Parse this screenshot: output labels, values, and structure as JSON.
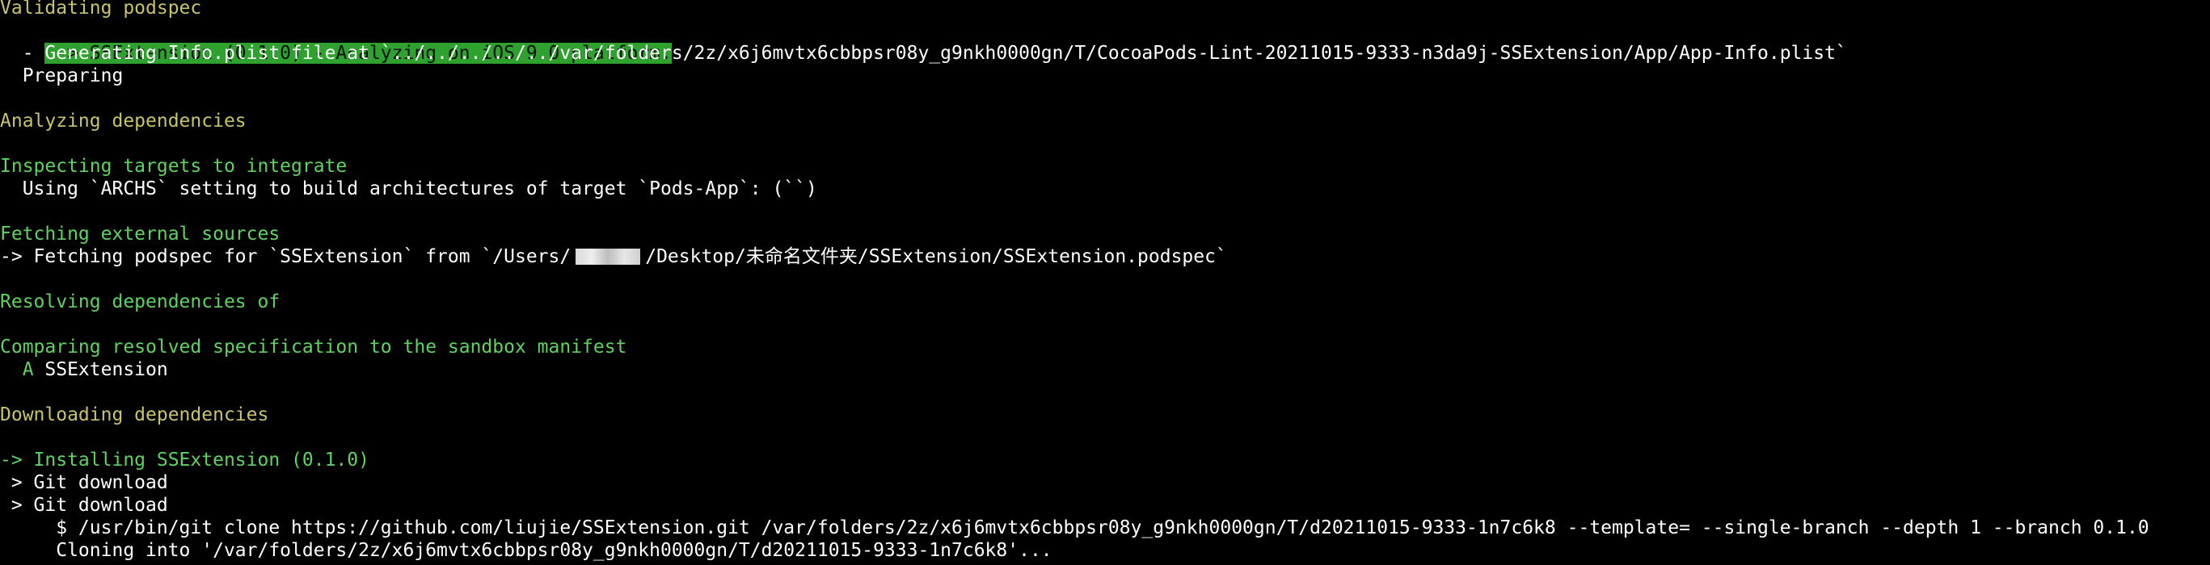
{
  "colors": {
    "background": "#000000",
    "section_yellow": "#c8c468",
    "section_green": "#5fd35f",
    "highlight": "#2ea12e"
  },
  "lines": {
    "validating": "Validating podspec",
    "analyzing_platform": " -> SSExtension (0.1.0) - Analyzing on iOS 9.0 platform.",
    "generating_info": "  - Generating Info.plist file at `../../../../../var/folders/2z/x6j6mvtx6cbbpsr08y_g9nkh0000gn/T/CocoaPods-Lint-20211015-9333-n3da9j-SSExtension/App/App-Info.plist`",
    "preparing": "  Preparing",
    "analyzing_deps": "Analyzing dependencies",
    "inspecting": "Inspecting targets to integrate",
    "using_archs": "  Using `ARCHS` setting to build architectures of target `Pods-App`: (``)",
    "fetching_external": "Fetching external sources",
    "fetching_prefix": "-> Fetching podspec for `SSExtension` from `/Users/",
    "fetching_suffix": "/Desktop/未命名文件夹/SSExtension/SSExtension.podspec`",
    "resolving": "Resolving dependencies of",
    "comparing": "Comparing resolved specification to the sandbox manifest",
    "added_marker": "  A",
    "added_pod": " SSExtension",
    "downloading": "Downloading dependencies",
    "installing": "-> Installing SSExtension (0.1.0)",
    "git_download_1": " > Git download",
    "git_download_2": " > Git download",
    "git_clone": "     $ /usr/bin/git clone https://github.com/liujie/SSExtension.git /var/folders/2z/x6j6mvtx6cbbpsr08y_g9nkh0000gn/T/d20211015-9333-1n7c6k8 --template= --single-branch --depth 1 --branch 0.1.0",
    "cloning_into": "     Cloning into '/var/folders/2z/x6j6mvtx6cbbpsr08y_g9nkh0000gn/T/d20211015-9333-1n7c6k8'..."
  }
}
